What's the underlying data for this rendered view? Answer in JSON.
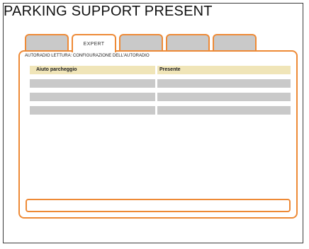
{
  "page": {
    "title": "PARKING SUPPORT PRESENT"
  },
  "tabs": [
    {
      "label": "",
      "active": false
    },
    {
      "label": "EXPERT",
      "active": true
    },
    {
      "label": "",
      "active": false
    },
    {
      "label": "",
      "active": false
    },
    {
      "label": "",
      "active": false
    }
  ],
  "panel": {
    "section_label": "AUTORADIO LETTURA: CONFIGURAZIONE DELL'AUTORADIO",
    "table": {
      "columns": [
        "Aiuto parcheggio",
        "Presente"
      ],
      "rows": [
        [
          "",
          ""
        ],
        [
          "",
          ""
        ],
        [
          "",
          ""
        ],
        [
          "",
          ""
        ]
      ]
    }
  },
  "status_bar": {
    "text": ""
  },
  "colors": {
    "accent": "#ee8a36",
    "header_fill": "#f0e5b8",
    "empty_fill": "#c9c9c9"
  }
}
